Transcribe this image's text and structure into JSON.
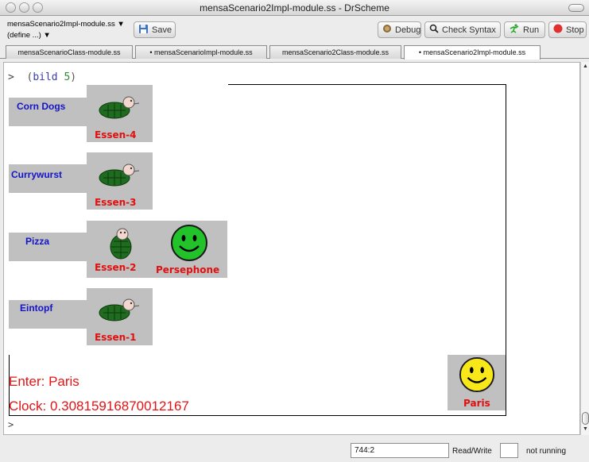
{
  "window": {
    "title": "mensaScenario2Impl-module.ss - DrScheme"
  },
  "toolbar": {
    "file_selector": "mensaScenario2Impl-module.ss ▼",
    "define_selector": "(define ...) ▼",
    "save_label": "Save",
    "debug_label": "Debug",
    "check_syntax_label": "Check Syntax",
    "run_label": "Run",
    "stop_label": "Stop"
  },
  "tabs": [
    {
      "label": "mensaScenarioClass-module.ss"
    },
    {
      "label": "• mensaScenarioImpl-module.ss"
    },
    {
      "label": "mensaScenario2Class-module.ss"
    },
    {
      "label": "• mensaScenario2Impl-module.ss"
    }
  ],
  "interactions": {
    "prompt": ">",
    "open_paren": "(",
    "keyword": "bild",
    "argument": "5",
    "close_paren": ")",
    "prompt_empty": ">"
  },
  "scene": {
    "foods": [
      {
        "name": "Corn Dogs",
        "station": "Essen-4"
      },
      {
        "name": "Currywurst",
        "station": "Essen-3"
      },
      {
        "name": "Pizza",
        "station": "Essen-2"
      },
      {
        "name": "Eintopf",
        "station": "Essen-1"
      }
    ],
    "persephone_label": "Persephone",
    "paris_label": "Paris",
    "enter_text": "Enter: Paris",
    "clock_text": "Clock: 0.30815916870012167"
  },
  "statusbar": {
    "position": "744:2",
    "read_write": "Read/Write",
    "running_state": "not running"
  },
  "colors": {
    "food_text": "#1414c8",
    "station_text": "#e01010",
    "smiley_green": "#22c22a",
    "smiley_yellow": "#f8e81a",
    "box_gray": "#c0c0c0"
  },
  "icons": {
    "turtle": "turtle-icon",
    "smiley": "smiley-face-icon"
  }
}
